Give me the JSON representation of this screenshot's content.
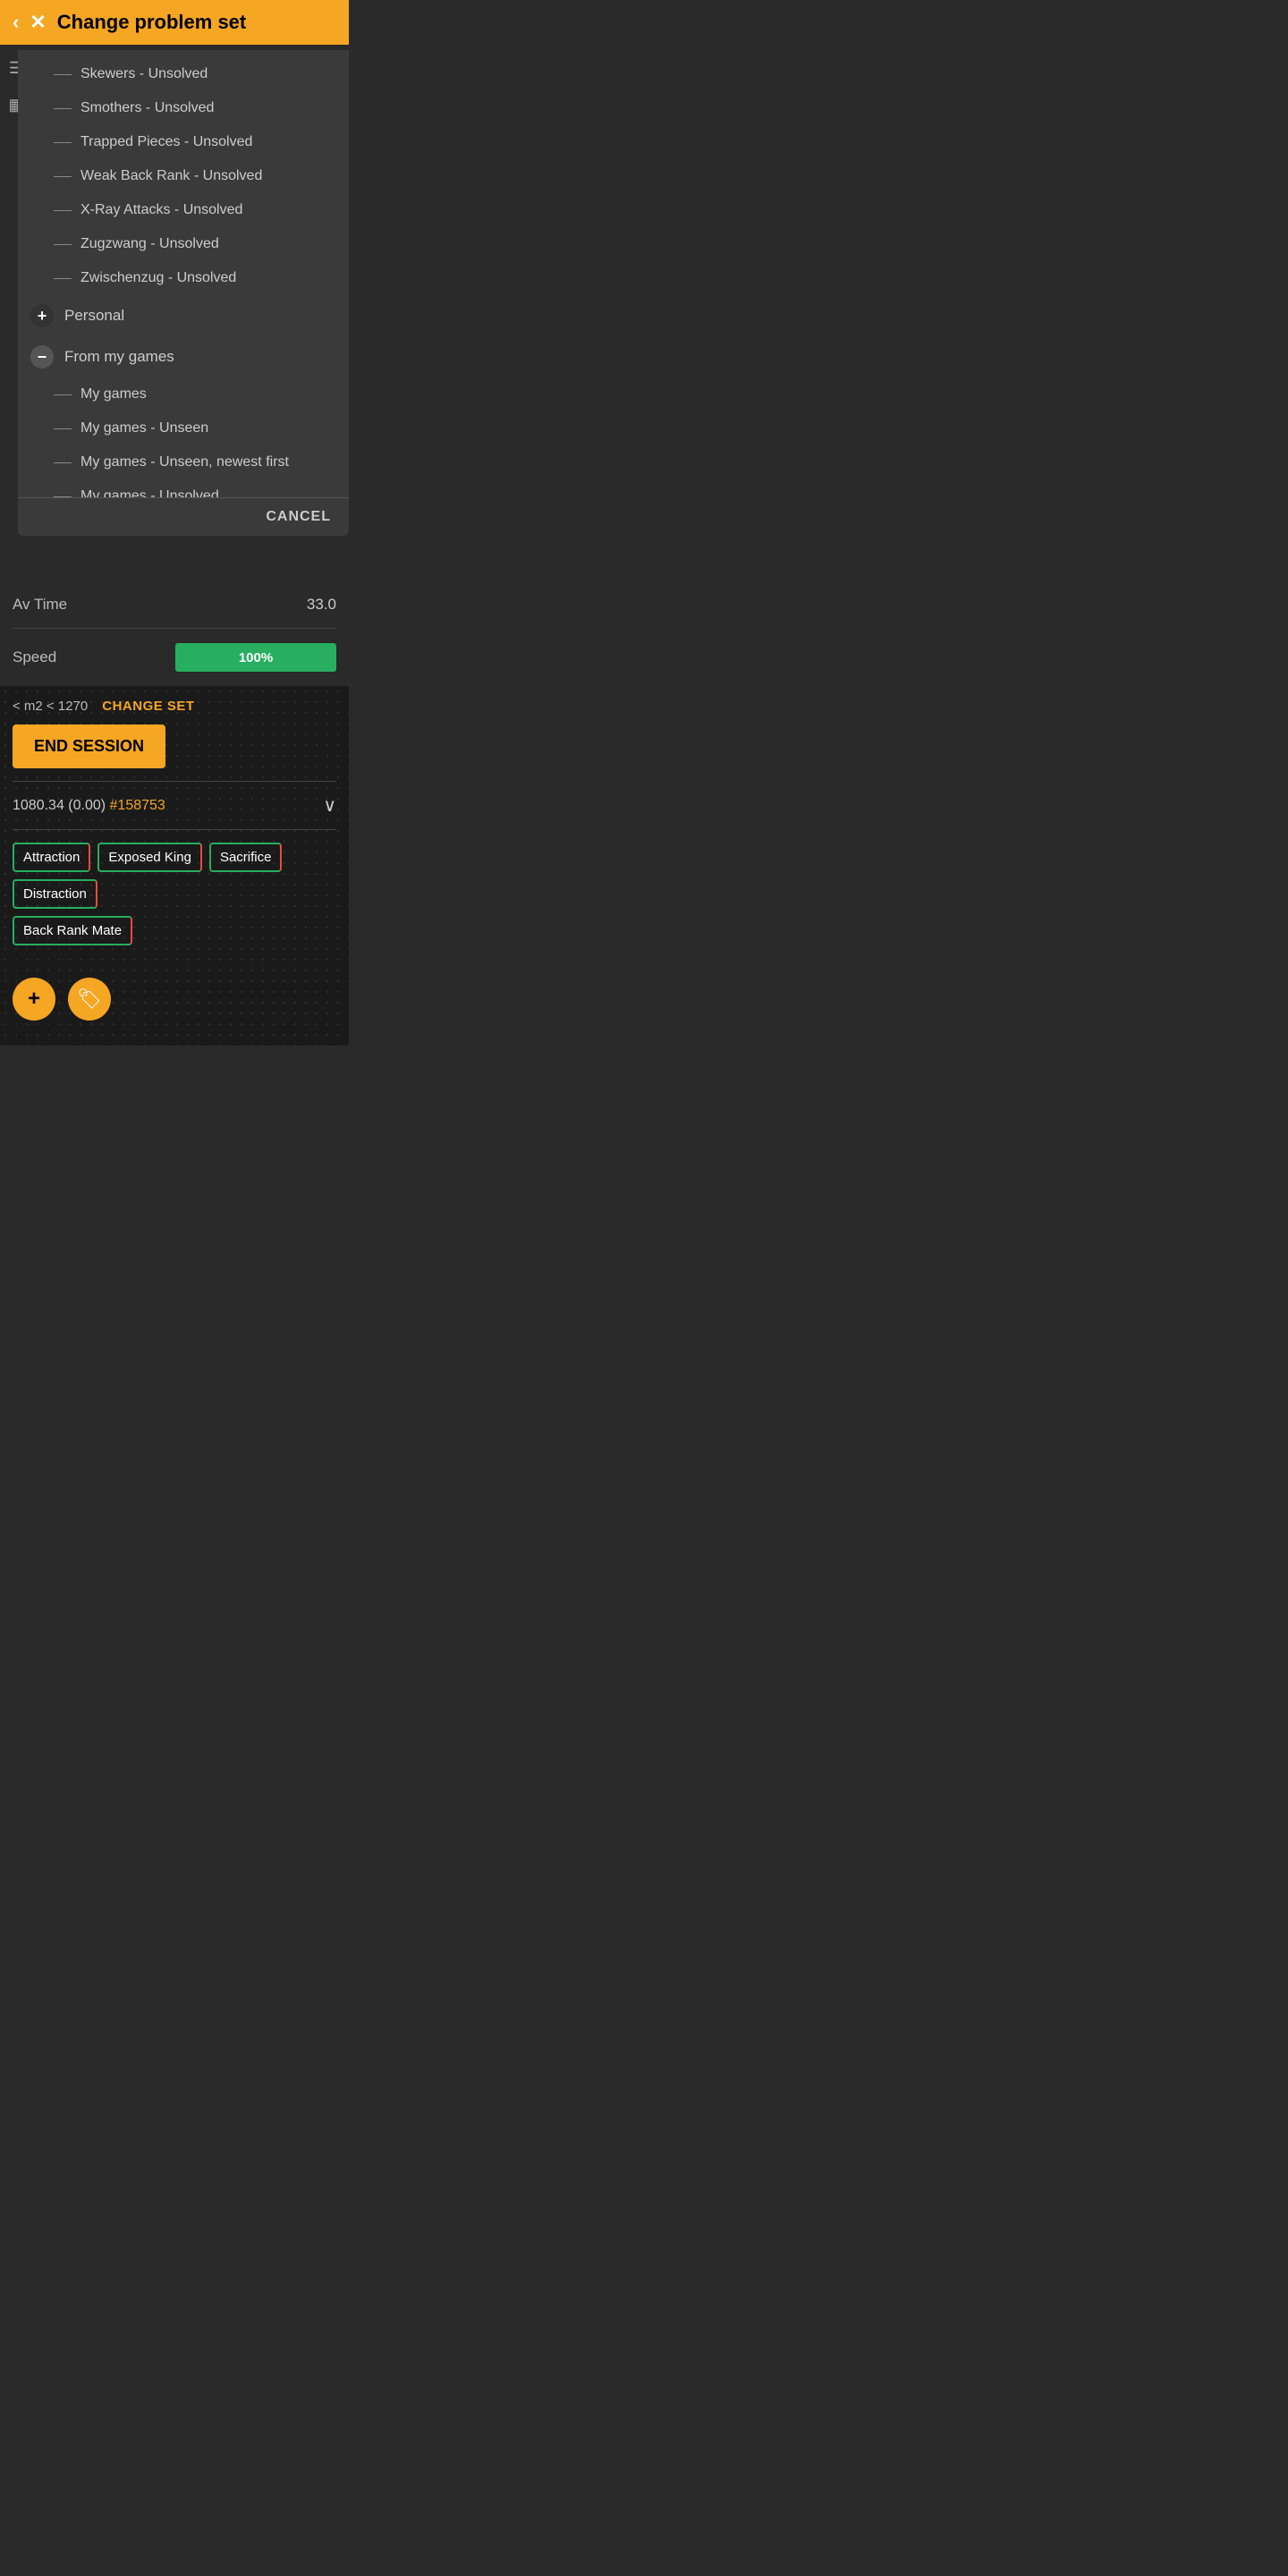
{
  "header": {
    "title": "Change problem set",
    "back_label": "‹",
    "close_label": "✕"
  },
  "sidebar": {
    "icons": [
      "☰",
      "▦"
    ]
  },
  "dropdown": {
    "items_indent": [
      "Skewers - Unsolved",
      "Smothers - Unsolved",
      "Trapped Pieces - Unsolved",
      "Weak Back Rank - Unsolved",
      "X-Ray Attacks - Unsolved",
      "Zugzwang - Unsolved",
      "Zwischenzug - Unsolved"
    ],
    "section_personal": "Personal",
    "section_from_my_games": "From my games",
    "my_games_items": [
      "My games",
      "My games - Unseen",
      "My games - Unseen, newest first",
      "My games - Unsolved"
    ],
    "cancel_label": "CANCEL"
  },
  "stats": {
    "av_time_label": "Av Time",
    "av_time_value": "33.0",
    "speed_label": "Speed",
    "speed_value": "100%"
  },
  "bottom": {
    "set_range": "< m2 < 1270",
    "change_set_label": "CHANGE SET",
    "end_session_label": "END SESSION",
    "score_text": "1080.34 (0.00)",
    "score_link": "#158753"
  },
  "tags": [
    "Attraction",
    "Exposed King",
    "Sacrifice",
    "Distraction",
    "Back Rank Mate"
  ],
  "actions": {
    "add_label": "+",
    "tag_icon": "🏷"
  }
}
